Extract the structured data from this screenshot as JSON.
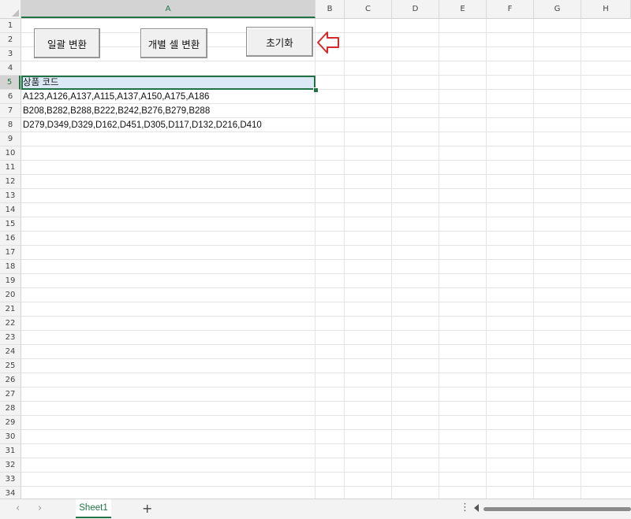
{
  "columns": [
    "A",
    "B",
    "C",
    "D",
    "E",
    "F",
    "G",
    "H"
  ],
  "rows": [
    "1",
    "2",
    "3",
    "4",
    "5",
    "6",
    "7",
    "8",
    "9",
    "10",
    "11",
    "12",
    "13",
    "14",
    "15",
    "16",
    "17",
    "18",
    "19",
    "20",
    "21",
    "22",
    "23",
    "24",
    "25",
    "26",
    "27",
    "28",
    "29",
    "30",
    "31",
    "32",
    "33",
    "34"
  ],
  "cells": {
    "a5": "상품 코드",
    "a6": "A123,A126,A137,A115,A137,A150,A175,A186",
    "a7": "B208,B282,B288,B222,B242,B276,B279,B288",
    "a8": "D279,D349,D329,D162,D451,D305,D117,D132,D216,D410"
  },
  "buttons": {
    "bulk_convert": "일괄 변환",
    "individual_convert": "개별 셀 변환",
    "reset": "초기화"
  },
  "sheet_tab": "Sheet1",
  "icons": {
    "arrow": "left-arrow-outline-red",
    "add_sheet": "+",
    "prev": "‹",
    "next": "›",
    "more": "⋮"
  },
  "colors": {
    "accent": "#217346",
    "arrow": "#d62828"
  }
}
